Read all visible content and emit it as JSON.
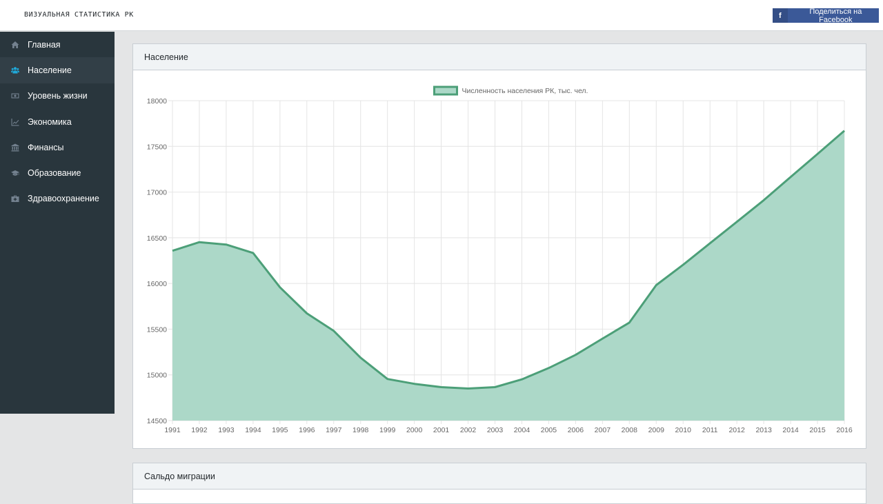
{
  "topbar": {
    "brand": "ВИЗУАЛЬНАЯ СТАТИСТИКА РК",
    "share_label": "Поделиться на Facebook",
    "share_icon": "f"
  },
  "sidebar": {
    "items": [
      {
        "label": "Главная",
        "icon": "home-icon",
        "active": false
      },
      {
        "label": "Население",
        "icon": "users-icon",
        "active": true
      },
      {
        "label": "Уровень жизни",
        "icon": "money-icon",
        "active": false
      },
      {
        "label": "Экономика",
        "icon": "line-chart-icon",
        "active": false
      },
      {
        "label": "Финансы",
        "icon": "bank-icon",
        "active": false
      },
      {
        "label": "Образование",
        "icon": "graduation-cap-icon",
        "active": false
      },
      {
        "label": "Здравоохранение",
        "icon": "medkit-icon",
        "active": false
      }
    ]
  },
  "cards": [
    {
      "title": "Население"
    },
    {
      "title": "Сальдо миграции"
    }
  ],
  "colors": {
    "line": "#4c9f78",
    "fill": "#acd8c8",
    "fb": "#3b5998",
    "sidebar": "#29363d",
    "active_icon": "#20a8d8"
  },
  "chart_data": {
    "type": "area",
    "legend_position": "top",
    "grid": true,
    "x": [
      "1991",
      "1992",
      "1993",
      "1994",
      "1995",
      "1996",
      "1997",
      "1998",
      "1999",
      "2000",
      "2001",
      "2002",
      "2003",
      "2004",
      "2005",
      "2006",
      "2007",
      "2008",
      "2009",
      "2010",
      "2011",
      "2012",
      "2013",
      "2014",
      "2015",
      "2016"
    ],
    "series": [
      {
        "name": "Численность населения РК, тыс. чел.",
        "values": [
          16358,
          16452,
          16426,
          16334,
          15958,
          15673,
          15481,
          15188,
          14955,
          14902,
          14866,
          14851,
          14866,
          14951,
          15075,
          15219,
          15397,
          15572,
          15982,
          16204,
          16440,
          16675,
          16911,
          17165,
          17416,
          17671
        ]
      }
    ],
    "ylim": [
      14500,
      18000
    ],
    "yticks": [
      14500,
      15000,
      15500,
      16000,
      16500,
      17000,
      17500,
      18000
    ]
  }
}
